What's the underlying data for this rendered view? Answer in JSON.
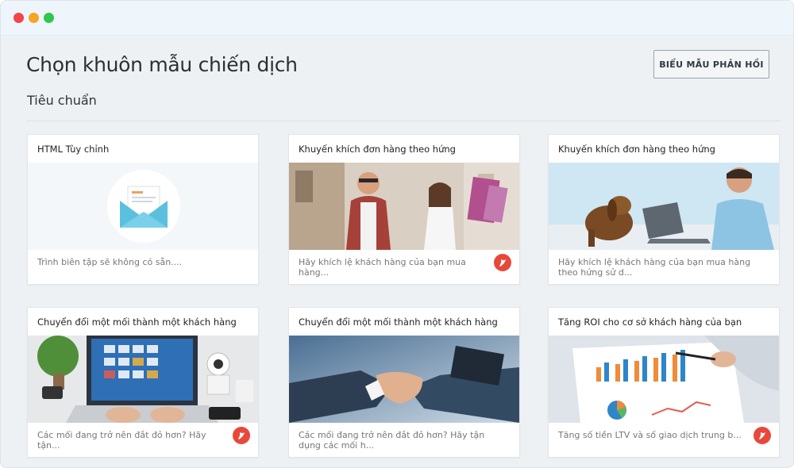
{
  "header": {
    "title": "Chọn khuôn mẫu chiến dịch",
    "feedback_button": "BIỂU MẪU PHẢN HỒI"
  },
  "section": {
    "title": "Tiêu chuẩn"
  },
  "cards": [
    {
      "title": "HTML Tùy chỉnh",
      "description": "Trình biên tập sẽ không có sẵn....",
      "badge": false,
      "image": "envelope-illustration"
    },
    {
      "title": "Khuyến khích đơn hàng theo hứng",
      "description": "Hãy khích lệ khách hàng của bạn mua hàng...",
      "badge": true,
      "image": "shopping-couple-photo"
    },
    {
      "title": "Khuyến khích đơn hàng theo hứng",
      "description": "Hãy khích lệ khách hàng của bạn mua hàng theo hứng sử d...",
      "badge": false,
      "image": "man-laptop-dog-photo"
    },
    {
      "title": "Chuyển đổi một mối thành một khách hàng",
      "description": "Các mối đang trở nên đắt đỏ hơn? Hãy tận...",
      "badge": true,
      "image": "laptop-desk-photo"
    },
    {
      "title": "Chuyển đổi một mối thành một khách hàng",
      "description": "Các mối đang trở nên đắt đỏ hơn? Hãy tận dụng các mối h...",
      "badge": false,
      "image": "handshake-photo"
    },
    {
      "title": "Tăng ROI cho cơ sở khách hàng của bạn",
      "description": "Tăng số tiền LTV và số giao dịch trung b...",
      "badge": true,
      "image": "chart-report-photo"
    }
  ],
  "colors": {
    "badge": "#e8483a",
    "envelope": "#5bc0de"
  }
}
